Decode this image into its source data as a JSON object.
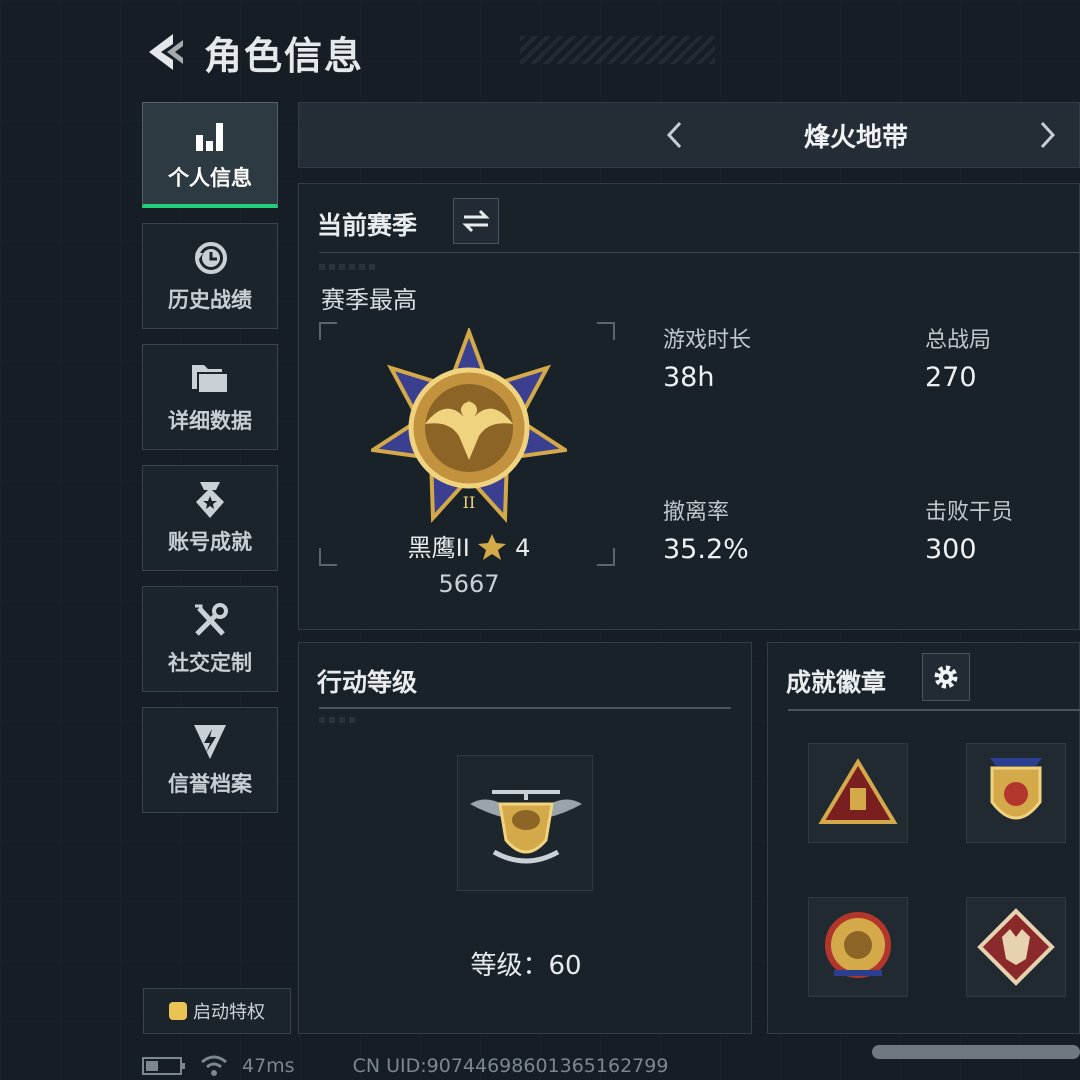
{
  "header": {
    "title": "角色信息",
    "back_icon": "back-arrow-icon"
  },
  "sidebar": {
    "items": [
      {
        "label": "个人信息",
        "icon": "bar-chart-icon",
        "active": true
      },
      {
        "label": "历史战绩",
        "icon": "history-clock-icon",
        "active": false
      },
      {
        "label": "详细数据",
        "icon": "folder-icon",
        "active": false
      },
      {
        "label": "账号成就",
        "icon": "medal-icon",
        "active": false
      },
      {
        "label": "社交定制",
        "icon": "tools-icon",
        "active": false
      },
      {
        "label": "信誉档案",
        "icon": "shield-bolt-icon",
        "active": false
      }
    ],
    "privilege_label": "启动特权"
  },
  "mode_selector": {
    "current": "烽火地带"
  },
  "season": {
    "title": "当前赛季",
    "subtitle": "赛季最高",
    "rank_name": "黑鹰II",
    "rank_stars": "4",
    "rank_points": "5667",
    "stats": [
      {
        "label": "游戏时长",
        "value": "38h"
      },
      {
        "label": "总战局",
        "value": "270"
      },
      {
        "label": "撤离率",
        "value": "35.2%"
      },
      {
        "label": "击败干员",
        "value": "300"
      }
    ]
  },
  "action_level": {
    "title": "行动等级",
    "level_label": "等级：",
    "level_value": "60"
  },
  "achievements": {
    "title": "成就徽章",
    "settings_icon": "gear-icon"
  },
  "status_bar": {
    "ping": "47ms",
    "uid": "CN UID:90744698601365162799"
  },
  "colors": {
    "accent_green": "#21d07a",
    "gold": "#d4a94a",
    "rank_blue": "#3b3f8f"
  }
}
